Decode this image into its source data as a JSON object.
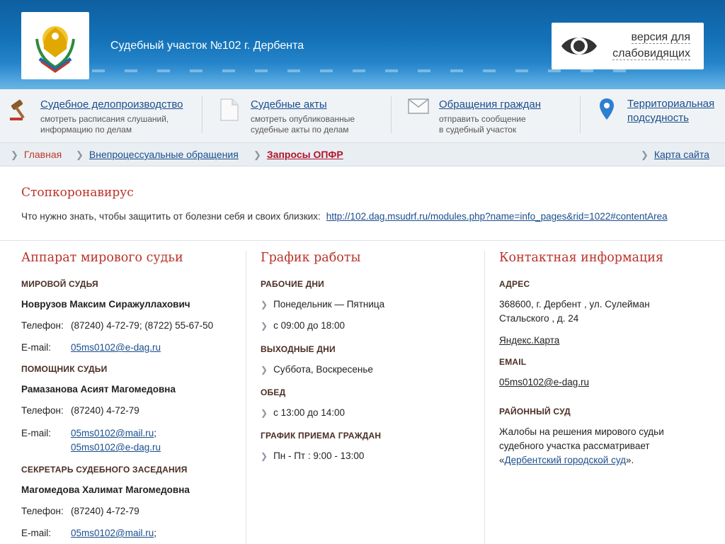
{
  "header": {
    "title": "Судебный участок №102 г. Дербента",
    "visually_impaired_line1": "версия для",
    "visually_impaired_line2": "слабовидящих",
    "logo_icon": "dagestan-emblem-icon",
    "brand_color": "#1472b8"
  },
  "services": [
    {
      "icon": "gavel-icon",
      "title": "Судебное делопроизводство",
      "desc1": "смотреть расписания слушаний,",
      "desc2": "информацию по делам"
    },
    {
      "icon": "document-icon",
      "title": "Судебные акты",
      "desc1": "смотреть опубликованные",
      "desc2": "судебные акты по делам"
    },
    {
      "icon": "envelope-icon",
      "title": "Обращения граждан",
      "desc1": "отправить сообщение",
      "desc2": "в судебный участок"
    },
    {
      "icon": "map-pin-icon",
      "title_line1": "Территориальная",
      "title_line2": "подсудность"
    }
  ],
  "breadcrumb": {
    "home": "Главная",
    "level1": "Внепроцессуальные обращения",
    "current": "Запросы ОПФР",
    "sitemap": "Карта сайта"
  },
  "notice": {
    "title": "Стопкоронавирус",
    "text": "Что нужно знать, чтобы защитить от болезни себя и своих близких:",
    "link": "http://102.dag.msudrf.ru/modules.php?name=info_pages&rid=1022#contentArea"
  },
  "staff": {
    "heading": "Аппарат мирового судьи",
    "judge_label": "МИРОВОЙ СУДЬЯ",
    "judge_name": "Новрузов Максим Сиражуллахович",
    "judge_phone_label": "Телефон:",
    "judge_phone": "(87240) 4-72-79; (8722) 55-67-50",
    "judge_email_label": "E-mail:",
    "judge_email": "05ms0102@e-dag.ru",
    "assistant_label": "ПОМОЩНИК СУДЬИ",
    "assistant_name": "Рамазанова Асият Магомедовна",
    "assistant_phone_label": "Телефон:",
    "assistant_phone": "(87240) 4-72-79",
    "assistant_email_label": "E-mail:",
    "assistant_email1": "05ms0102@mail.ru",
    "assistant_email2": "05ms0102@e-dag.ru",
    "secretary_label": "СЕКРЕТАРЬ СУДЕБНОГО ЗАСЕДАНИЯ",
    "secretary_name": "Магомедова Халимат Магомедовна",
    "secretary_phone_label": "Телефон:",
    "secretary_phone": "(87240) 4-72-79",
    "secretary_email_label": "E-mail:",
    "secretary_email1": "05ms0102@mail.ru"
  },
  "schedule": {
    "heading": "График работы",
    "workdays_label": "РАБОЧИЕ ДНИ",
    "workdays": "Понедельник — Пятница",
    "workhours": "с 09:00 до 18:00",
    "weekend_label": "ВЫХОДНЫЕ ДНИ",
    "weekend": "Суббота, Воскресенье",
    "lunch_label": "ОБЕД",
    "lunch": "с 13:00 до 14:00",
    "reception_label": "ГРАФИК ПРИЕМА ГРАЖДАН",
    "reception": "Пн - Пт : 9:00 - 13:00"
  },
  "contacts": {
    "heading": "Контактная информация",
    "address_label": "АДРЕС",
    "address_line1": "368600, г. Дербент , ул. Сулейман",
    "address_line2": "Стальского , д. 24",
    "map_link": "Яндекс.Карта",
    "email_label": "EMAIL",
    "email": "05ms0102@e-dag.ru",
    "district_label": "РАЙОННЫЙ СУД",
    "district_line1": "Жалобы на решения мирового судьи",
    "district_line2": "судебного участка рассматривает",
    "district_link": "Дербентский городской суд",
    "district_quote_open": "«",
    "district_quote_close": "»."
  }
}
